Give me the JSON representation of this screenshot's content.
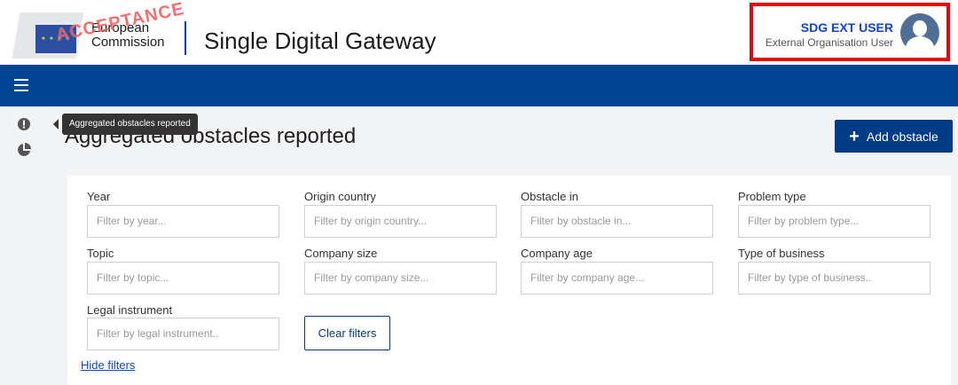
{
  "header": {
    "logo_text_line1": "European",
    "logo_text_line2": "Commission",
    "stamp": "ACCEPTANCE",
    "site_title": "Single Digital Gateway",
    "user_name": "SDG EXT USER",
    "user_role": "External Organisation User"
  },
  "sidebar": {
    "tooltip": "Aggregated obstacles reported",
    "items": [
      {
        "icon": "exclamation-circle-icon"
      },
      {
        "icon": "pie-chart-icon"
      }
    ]
  },
  "main": {
    "page_title": "Aggregated obstacles reported",
    "add_button_label": "Add obstacle",
    "filters": [
      {
        "label": "Year",
        "placeholder": "Filter by year..."
      },
      {
        "label": "Origin country",
        "placeholder": "Filter by origin country..."
      },
      {
        "label": "Obstacle in",
        "placeholder": "Filter by obstacle in..."
      },
      {
        "label": "Problem type",
        "placeholder": "Filter by problem type..."
      },
      {
        "label": "Topic",
        "placeholder": "Filter by topic..."
      },
      {
        "label": "Company size",
        "placeholder": "Filter by company size..."
      },
      {
        "label": "Company age",
        "placeholder": "Filter by company age..."
      },
      {
        "label": "Type of business",
        "placeholder": "Filter by type of business.."
      },
      {
        "label": "Legal instrument",
        "placeholder": "Filter by legal instrument.."
      }
    ],
    "clear_filters_label": "Clear filters",
    "hide_filters_label": "Hide filters"
  },
  "colors": {
    "nav_blue": "#004494",
    "primary_button": "#003b87",
    "highlight_border": "#e8000b",
    "link_blue": "#0e47cb"
  }
}
